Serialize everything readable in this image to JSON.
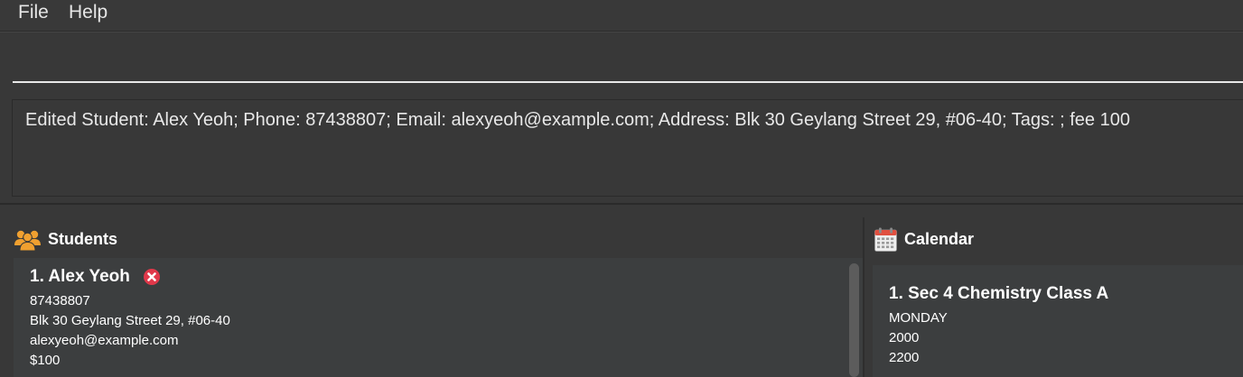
{
  "menu": {
    "file_label": "File",
    "help_label": "Help"
  },
  "command_box": {
    "value": "",
    "placeholder": ""
  },
  "result_display": {
    "text": "Edited Student: Alex Yeoh; Phone: 87438807; Email: alexyeoh@example.com; Address: Blk 30 Geylang Street 29, #06-40; Tags: ; fee 100"
  },
  "students_panel": {
    "title": "Students",
    "icon": "people-group-icon",
    "cards": [
      {
        "index_name": "1. Alex Yeoh",
        "phone": "87438807",
        "address": "Blk 30 Geylang Street 29, #06-40",
        "email": "alexyeoh@example.com",
        "fee": "$100"
      }
    ]
  },
  "calendar_panel": {
    "title": "Calendar",
    "icon": "calendar-icon",
    "cards": [
      {
        "index_name": "1. Sec 4 Chemistry Class A",
        "day": "MONDAY",
        "start_time": "2000",
        "end_time": "2200"
      }
    ]
  },
  "colors": {
    "background": "#383838",
    "card_background": "#3c3e3f",
    "accent_orange": "#f0a030",
    "delete_red": "#e0384a",
    "calendar_red": "#e05040"
  }
}
